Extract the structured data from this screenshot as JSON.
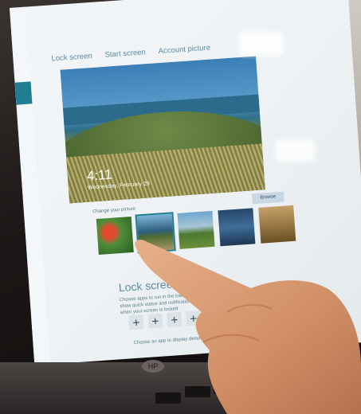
{
  "settings": {
    "tabs": [
      {
        "label": "Lock screen"
      },
      {
        "label": "Start screen"
      },
      {
        "label": "Account picture"
      }
    ],
    "preview": {
      "time": "4:11",
      "date": "Wednesday, February 29"
    },
    "browse_label": "Browse",
    "change_picture_label": "Change your picture",
    "thumbnails": [
      "flower",
      "coastal-grass",
      "mountain-road",
      "blue-abstract",
      "dry-grass"
    ],
    "lock_screen_apps": {
      "title": "Lock screen apps",
      "description": "Choose apps to run in the background and show quick status and notifications, even when your screen is locked",
      "add_buttons": [
        "+",
        "+",
        "+",
        "+"
      ],
      "footer": "Choose an app to display detailed status"
    }
  },
  "device": {
    "logo": "HP"
  },
  "colors": {
    "accent": "#1f7f90",
    "heading": "#5b8aa0",
    "tile": "#dbe3e8"
  }
}
